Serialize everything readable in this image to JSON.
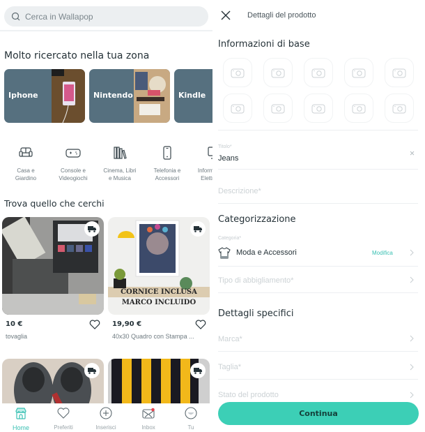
{
  "left": {
    "search": {
      "placeholder": "Cerca in Wallapop",
      "icon": "search-icon"
    },
    "trending": {
      "title": "Molto ricercato nella tua zona",
      "items": [
        {
          "label": "Iphone"
        },
        {
          "label": "Nintendo"
        },
        {
          "label": "Kindle"
        }
      ]
    },
    "categories": [
      {
        "label1": "Casa e",
        "label2": "Giardino",
        "icon": "sofa-icon"
      },
      {
        "label1": "Console e",
        "label2": "Videogiochi",
        "icon": "gamepad-icon"
      },
      {
        "label1": "Cinema, Libri",
        "label2": "e Musica",
        "icon": "books-icon"
      },
      {
        "label1": "Telefonia e",
        "label2": "Accessori",
        "icon": "phone-icon"
      },
      {
        "label1": "Informatica e",
        "label2": "Elettronica",
        "icon": "monitor-icon"
      }
    ],
    "feed": {
      "title": "Trova quello che cerchi",
      "items": [
        {
          "price": "10 €",
          "name": "tovaglia",
          "shipping": true
        },
        {
          "price": "19,90 €",
          "name": "40x30 Quadro con Stampa ...",
          "shipping": true,
          "overlay1": "CORNICE INCLUSA",
          "overlay2": "MARCO INCLUIDO"
        },
        {
          "shipping": true
        },
        {
          "shipping": true
        }
      ]
    },
    "bottom_nav": [
      {
        "label": "Home",
        "icon": "home-store-icon",
        "active": true
      },
      {
        "label": "Preferiti",
        "icon": "heart-icon"
      },
      {
        "label": "Inserisci",
        "icon": "plus-circle-icon"
      },
      {
        "label": "Inbox",
        "icon": "mail-icon",
        "badge": true
      },
      {
        "label": "Tu",
        "icon": "user-smile-icon"
      }
    ],
    "colors": {
      "accent": "#3ac0b3",
      "trend_bg": "#56707f"
    }
  },
  "right": {
    "header": {
      "title": "Dettagli del prodotto"
    },
    "basic": {
      "title": "Informazioni di base",
      "photo_slots": 10,
      "title_field": {
        "label": "Titolo*",
        "value": "Jeans"
      },
      "description_field": {
        "placeholder": "Descrizione*"
      }
    },
    "categorization": {
      "title": "Categorizzazione",
      "category": {
        "label": "Categoria*",
        "value": "Moda e Accessori",
        "action": "Modifica"
      },
      "type": {
        "placeholder": "Tipo di abbigliamento*"
      }
    },
    "specific": {
      "title": "Dettagli specifici",
      "fields": [
        {
          "placeholder": "Marca*"
        },
        {
          "placeholder": "Taglia*"
        },
        {
          "placeholder": "Stato del prodotto"
        }
      ]
    },
    "continue_label": "Continua",
    "colors": {
      "button": "#3ccfb6"
    }
  }
}
